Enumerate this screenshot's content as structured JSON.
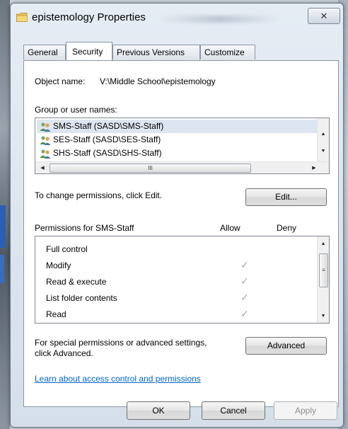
{
  "window": {
    "title": "epistemology Properties",
    "close_label": "✕"
  },
  "tabs": [
    {
      "label": "General",
      "active": false
    },
    {
      "label": "Security",
      "active": true
    },
    {
      "label": "Previous Versions",
      "active": false
    },
    {
      "label": "Customize",
      "active": false
    }
  ],
  "object": {
    "label": "Object name:",
    "value": "V:\\Middle School\\epistemology"
  },
  "groups": {
    "label": "Group or user names:",
    "items": [
      {
        "name": "SMS-Staff (SASD\\SMS-Staff)",
        "selected": true
      },
      {
        "name": "SES-Staff (SASD\\SES-Staff)",
        "selected": false
      },
      {
        "name": "SHS-Staff (SASD\\SHS-Staff)",
        "selected": false
      }
    ],
    "hscroll_grip": "III"
  },
  "change": {
    "text": "To change permissions, click Edit.",
    "edit_label": "Edit..."
  },
  "permissions": {
    "title": "Permissions for SMS-Staff",
    "allow_header": "Allow",
    "deny_header": "Deny",
    "check_glyph": "✓",
    "rows": [
      {
        "name": "Full control",
        "allow": false,
        "deny": false
      },
      {
        "name": "Modify",
        "allow": true,
        "deny": false
      },
      {
        "name": "Read & execute",
        "allow": true,
        "deny": false
      },
      {
        "name": "List folder contents",
        "allow": true,
        "deny": false
      },
      {
        "name": "Read",
        "allow": true,
        "deny": false
      }
    ],
    "grip": "≡"
  },
  "advanced": {
    "text_line1": "For special permissions or advanced settings,",
    "text_line2": "click Advanced.",
    "button_label": "Advanced"
  },
  "link": {
    "text": "Learn about access control and permissions"
  },
  "footer": {
    "ok_label": "OK",
    "cancel_label": "Cancel",
    "apply_label": "Apply"
  }
}
